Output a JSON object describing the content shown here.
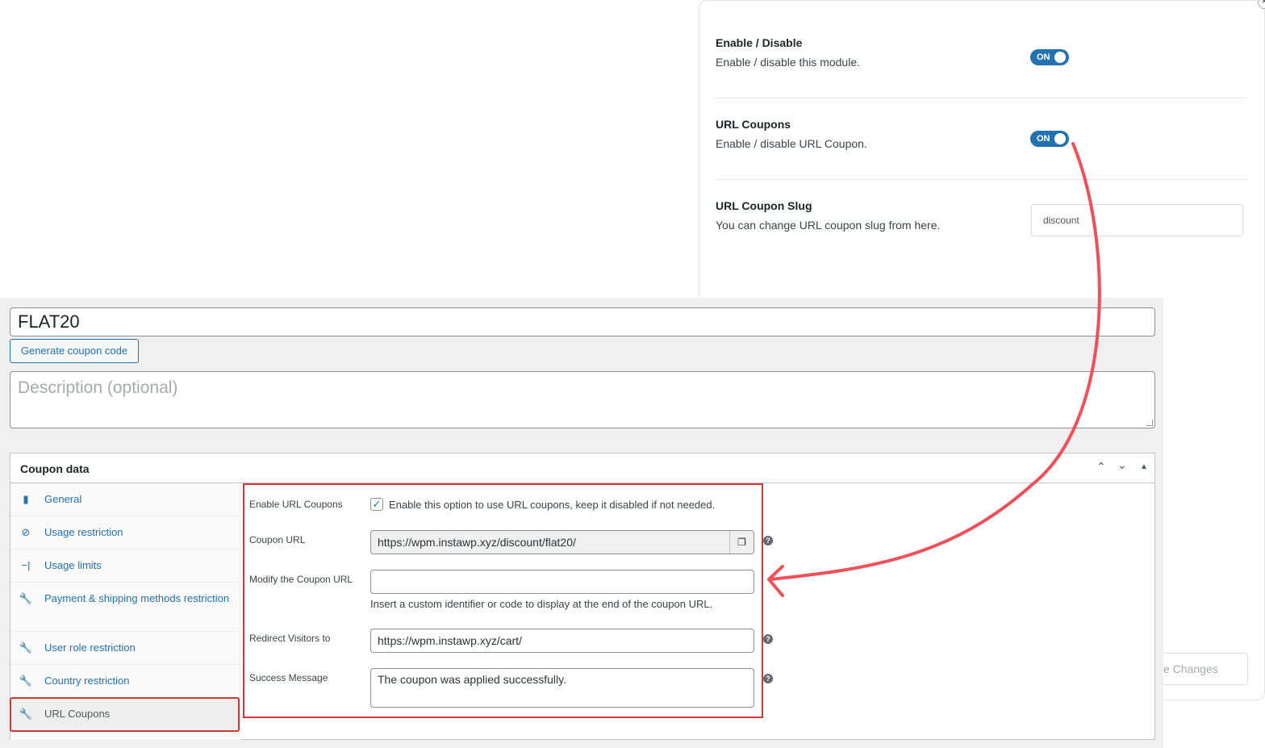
{
  "settings": {
    "close_symbol": "×",
    "rows": [
      {
        "title": "Enable / Disable",
        "desc": "Enable / disable this module."
      },
      {
        "title": "URL Coupons",
        "desc": "Enable / disable URL Coupon."
      },
      {
        "title": "URL Coupon Slug",
        "desc": "You can change URL coupon slug from here."
      }
    ],
    "toggle_on_label": "ON",
    "slug_value": "discount",
    "save_label": "e Changes"
  },
  "editor": {
    "coupon_code": "FLAT20",
    "generate_label": "Generate coupon code",
    "description_placeholder": "Description (optional)",
    "coupon_data_title": "Coupon data",
    "tabs": [
      {
        "label": "General",
        "icon": "ticket-icon"
      },
      {
        "label": "Usage restriction",
        "icon": "no-entry-icon"
      },
      {
        "label": "Usage limits",
        "icon": "limits-icon"
      },
      {
        "label": "Payment & shipping methods restriction",
        "icon": "wrench-icon"
      },
      {
        "label": "User role restriction",
        "icon": "wrench-icon"
      },
      {
        "label": "Country restriction",
        "icon": "wrench-icon"
      },
      {
        "label": "URL Coupons",
        "icon": "wrench-icon"
      }
    ],
    "fields": {
      "enable_label": "Enable URL Coupons",
      "enable_help": "Enable this option to use URL coupons, keep it disabled if not needed.",
      "enable_checked": true,
      "coupon_url_label": "Coupon URL",
      "coupon_url_value": "https://wpm.instawp.xyz/discount/flat20/",
      "modify_label": "Modify the Coupon URL",
      "modify_value": "",
      "modify_help": "Insert a custom identifier or code to display at the end of the coupon URL.",
      "redirect_label": "Redirect Visitors to",
      "redirect_value": "https://wpm.instawp.xyz/cart/",
      "success_label": "Success Message",
      "success_value": "The coupon was applied successfully."
    }
  },
  "colors": {
    "accent": "#2271b1",
    "highlight_red": "#d63638",
    "arrow_red": "#f0505a"
  }
}
